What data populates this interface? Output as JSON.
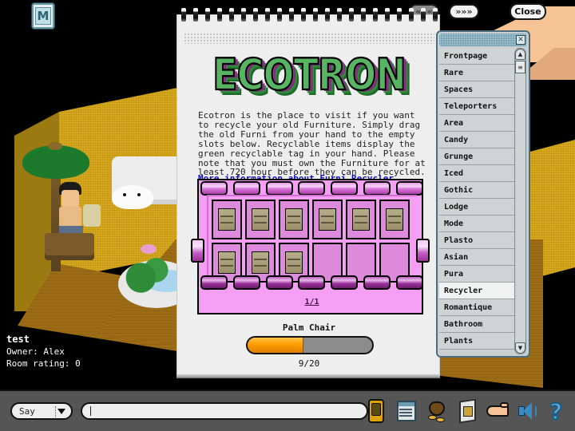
{
  "window": {
    "m_button_label": "M",
    "nav_prev": "«««",
    "nav_next": "»»»",
    "close_label": "Close"
  },
  "room": {
    "name": "test",
    "owner": "Owner: Alex",
    "rating": "Room rating: 0"
  },
  "ecotron": {
    "logo": "ECOTRON",
    "description": "Ecotron is the place to visit if you want to recycle your old Furniture. Simply drag the old Furni from your hand to the empty slots below. Recyclable items display the green recyclable tag in your hand. Please note that you must own the Furniture for at least 720 hour before they can be recycled.",
    "link": "More information about Furni Recycler",
    "page_indicator": "1/1",
    "item_name": "Palm Chair",
    "progress_label": "9/20",
    "progress_current": 9,
    "progress_total": 20,
    "progress_percent": 45,
    "slots": [
      {
        "filled": true,
        "item": "bookshelf"
      },
      {
        "filled": true,
        "item": "bookshelf"
      },
      {
        "filled": true,
        "item": "bookshelf"
      },
      {
        "filled": true,
        "item": "bookshelf"
      },
      {
        "filled": true,
        "item": "bookshelf"
      },
      {
        "filled": true,
        "item": "bookshelf"
      },
      {
        "filled": true,
        "item": "bookshelf"
      },
      {
        "filled": true,
        "item": "bookshelf"
      },
      {
        "filled": true,
        "item": "bookshelf"
      },
      {
        "filled": false,
        "item": ""
      },
      {
        "filled": false,
        "item": ""
      },
      {
        "filled": false,
        "item": ""
      }
    ],
    "colors": {
      "machine_body": "#f49ef4",
      "slot_bg": "#dd8add",
      "logo_green": "#57b463",
      "logo_purple": "#9b3f96",
      "progress_fill": "#ff9d00",
      "link_blue": "#1111cc"
    }
  },
  "catalog": {
    "close_icon": "✕",
    "scroll_up_icon": "▲",
    "scroll_down_icon": "▼",
    "scroll_thumb_icon": "≡",
    "selected": "Recycler",
    "items": [
      {
        "label": "Frontpage"
      },
      {
        "label": "Rare"
      },
      {
        "label": "Spaces"
      },
      {
        "label": "Teleporters"
      },
      {
        "label": "Area"
      },
      {
        "label": "Candy"
      },
      {
        "label": "Grunge"
      },
      {
        "label": "Iced"
      },
      {
        "label": "Gothic"
      },
      {
        "label": "Lodge"
      },
      {
        "label": "Mode"
      },
      {
        "label": "Plasto"
      },
      {
        "label": "Asian"
      },
      {
        "label": "Pura"
      },
      {
        "label": "Recycler"
      },
      {
        "label": "Romantique"
      },
      {
        "label": "Bathroom"
      },
      {
        "label": "Plants"
      }
    ]
  },
  "bottom_bar": {
    "chat_mode": "Say",
    "chat_value": "",
    "chat_placeholder": "",
    "icons": [
      {
        "name": "console-icon"
      },
      {
        "name": "navigator-icon"
      },
      {
        "name": "purse-icon"
      },
      {
        "name": "catalog-icon"
      },
      {
        "name": "hand-icon"
      },
      {
        "name": "sound-icon"
      },
      {
        "name": "help-icon"
      }
    ]
  }
}
